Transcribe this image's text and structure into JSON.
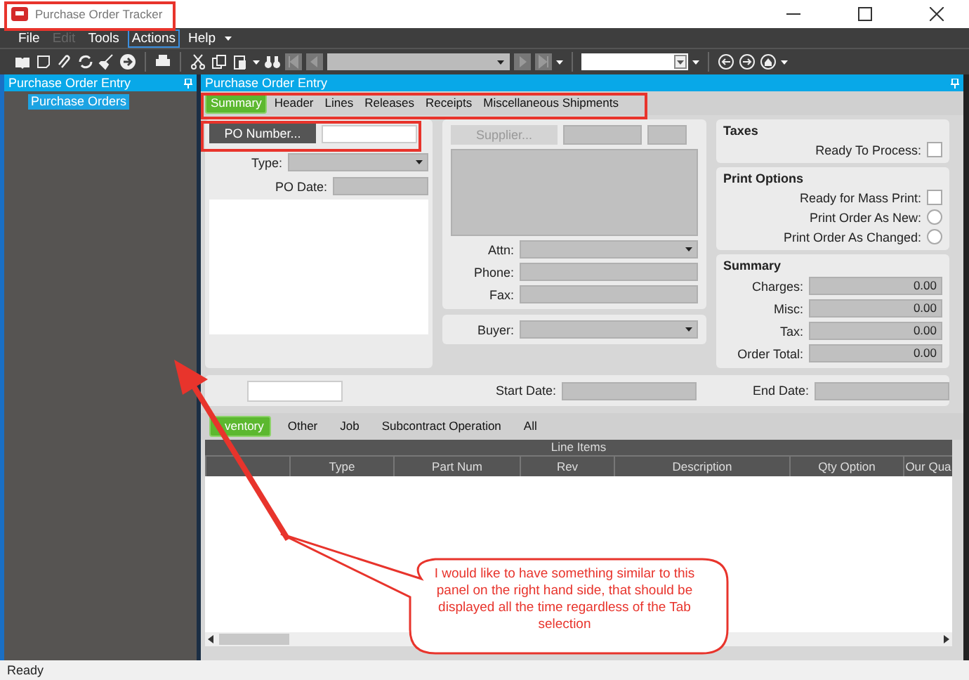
{
  "window": {
    "title": "Purchase Order Tracker"
  },
  "menu": [
    {
      "label": "File",
      "disabled": false,
      "selected": false
    },
    {
      "label": "Edit",
      "disabled": true,
      "selected": false
    },
    {
      "label": "Tools",
      "disabled": false,
      "selected": false
    },
    {
      "label": "Actions",
      "disabled": false,
      "selected": true
    },
    {
      "label": "Help",
      "disabled": false,
      "selected": false
    }
  ],
  "navigator": {
    "title": "Purchase Order Entry",
    "items": [
      {
        "label": "Purchase Orders",
        "selected": true
      }
    ]
  },
  "panel": {
    "title": "Purchase Order Entry",
    "tabs": [
      {
        "label": "Summary",
        "selected": true
      },
      {
        "label": "Header",
        "selected": false
      },
      {
        "label": "Lines",
        "selected": false
      },
      {
        "label": "Releases",
        "selected": false
      },
      {
        "label": "Receipts",
        "selected": false
      },
      {
        "label": "Miscellaneous Shipments",
        "selected": false
      }
    ],
    "po_button": "PO Number...",
    "type_label": "Type:",
    "po_date_label": "PO Date:",
    "supplier_button": {
      "label": "Supplier...",
      "disabled": true
    },
    "attn_label": "Attn:",
    "phone_label": "Phone:",
    "fax_label": "Fax:",
    "buyer_label": "Buyer:",
    "taxes": {
      "title": "Taxes",
      "label": "Ready To Process:",
      "checked": false
    },
    "print_options": {
      "title": "Print Options",
      "items": [
        {
          "kind": "checkbox",
          "label": "Ready for Mass Print:",
          "checked": false
        },
        {
          "kind": "radio",
          "label": "Print Order As New:",
          "checked": false
        },
        {
          "kind": "radio",
          "label": "Print Order As Changed:",
          "checked": false
        }
      ]
    },
    "summary": {
      "title": "Summary",
      "rows": [
        {
          "label": "Charges:",
          "value": "0.00"
        },
        {
          "label": "Misc:",
          "value": "0.00"
        },
        {
          "label": "Tax:",
          "value": "0.00"
        },
        {
          "label": "Order Total:",
          "value": "0.00"
        }
      ]
    },
    "start_date_label": "Start Date:",
    "end_date_label": "End Date:",
    "line_tabs": [
      {
        "label": "ventory",
        "selected": true
      },
      {
        "label": "Other",
        "selected": false
      },
      {
        "label": "Job",
        "selected": false
      },
      {
        "label": "Subcontract Operation",
        "selected": false
      },
      {
        "label": "All",
        "selected": false
      }
    ],
    "grid": {
      "title": "Line Items",
      "columns": [
        "Type",
        "Part Num",
        "Rev",
        "Description",
        "Qty Option",
        "Our Qua"
      ]
    }
  },
  "status_bar": "Ready",
  "annotation": {
    "text": "I would like to have something similar to this panel on the right hand side, that should be displayed all the time regardless of the Tab selection"
  }
}
